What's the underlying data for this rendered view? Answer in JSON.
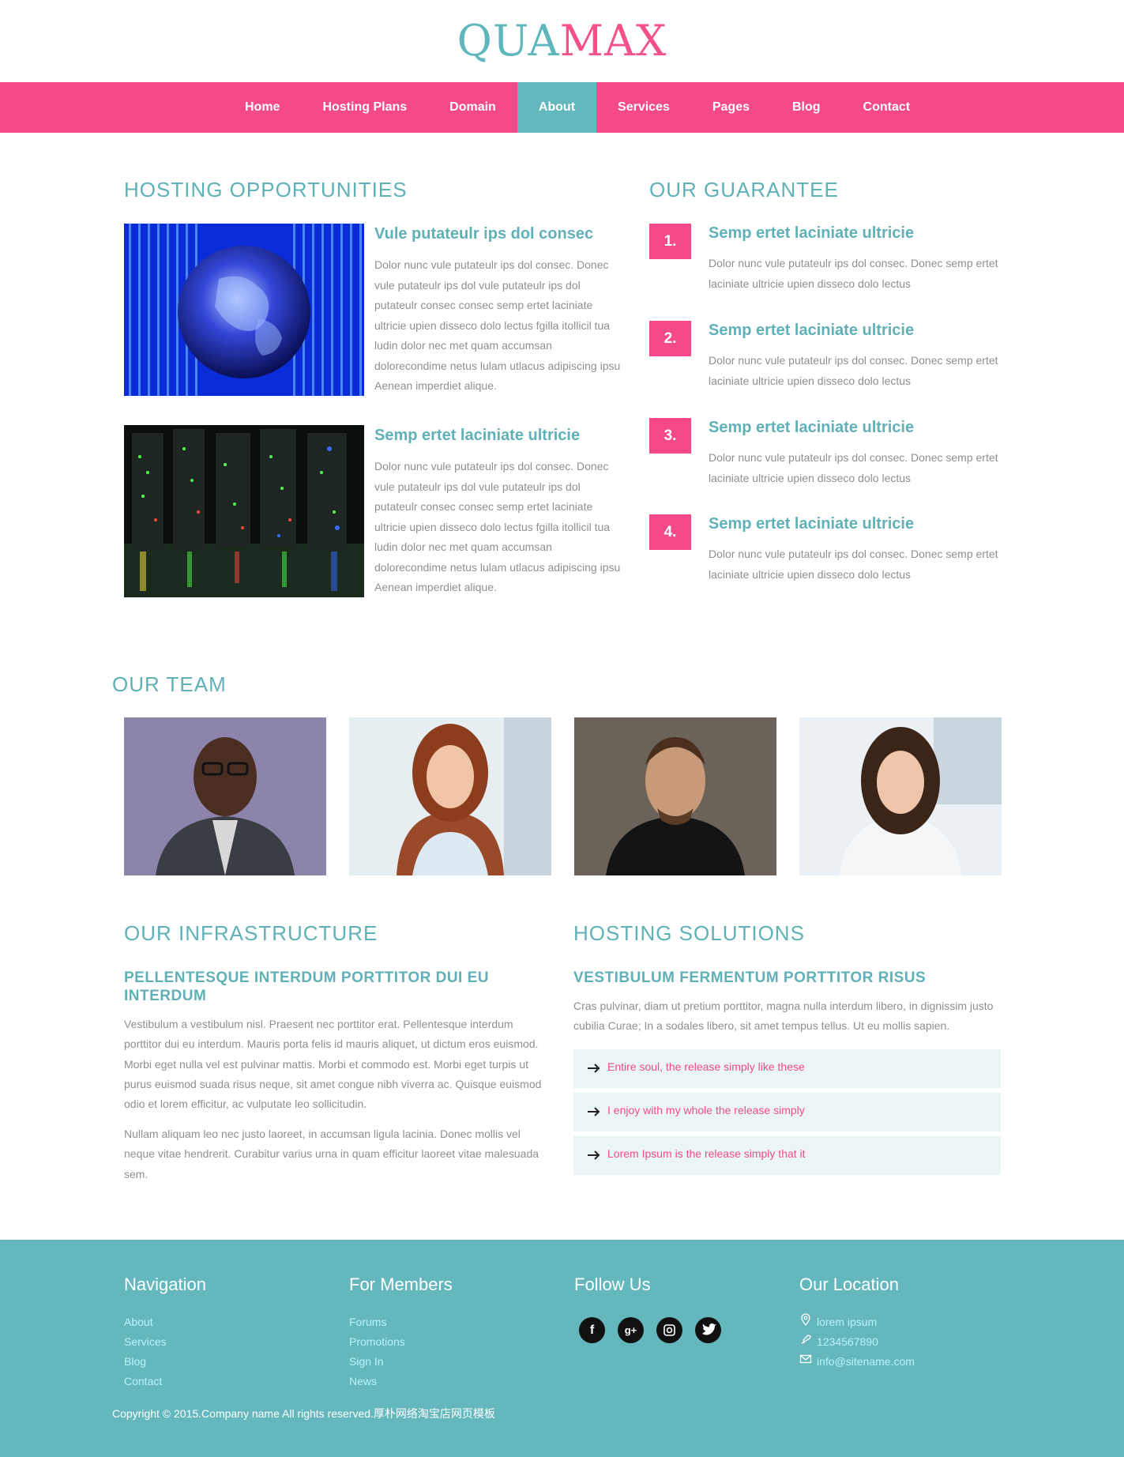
{
  "brand": {
    "part1": "QUA",
    "part2": "MAX",
    "color_primary": "#5fb7bd",
    "color_accent": "#f5508a"
  },
  "nav": {
    "items": [
      {
        "label": "Home"
      },
      {
        "label": "Hosting Plans"
      },
      {
        "label": "Domain"
      },
      {
        "label": "About",
        "active": true
      },
      {
        "label": "Services"
      },
      {
        "label": "Pages"
      },
      {
        "label": "Blog"
      },
      {
        "label": "Contact"
      }
    ]
  },
  "opportunities": {
    "heading": "HOSTING OPPORTUNITIES",
    "items": [
      {
        "title": "Vule putateulr ips dol consec",
        "text": "Dolor nunc vule putateulr ips dol consec. Donec vule putateulr ips dol vule putateulr ips dol putateulr consec consec semp ertet laciniate ultricie upien disseco dolo lectus fgilla itollicil tua ludin dolor nec met quam accumsan dolorecondime netus lulam utlacus adipiscing ipsu Aenean imperdiet alique.",
        "image": "globe-binary-image"
      },
      {
        "title": "Semp ertet laciniate ultricie",
        "text": "Dolor nunc vule putateulr ips dol consec. Donec vule putateulr ips dol vule putateulr ips dol putateulr consec consec semp ertet laciniate ultricie upien disseco dolo lectus fgilla itollicil tua ludin dolor nec met quam accumsan dolorecondime netus lulam utlacus adipiscing ipsu Aenean imperdiet alique.",
        "image": "server-room-image"
      }
    ]
  },
  "guarantee": {
    "heading": "OUR GUARANTEE",
    "items": [
      {
        "num": "1.",
        "title": "Semp ertet laciniate ultricie",
        "text": "Dolor nunc vule putateulr ips dol consec. Donec semp ertet laciniate ultricie upien disseco dolo lectus"
      },
      {
        "num": "2.",
        "title": "Semp ertet laciniate ultricie",
        "text": "Dolor nunc vule putateulr ips dol consec. Donec semp ertet laciniate ultricie upien disseco dolo lectus"
      },
      {
        "num": "3.",
        "title": "Semp ertet laciniate ultricie",
        "text": "Dolor nunc vule putateulr ips dol consec. Donec semp ertet laciniate ultricie upien disseco dolo lectus"
      },
      {
        "num": "4.",
        "title": "Semp ertet laciniate ultricie",
        "text": "Dolor nunc vule putateulr ips dol consec. Donec semp ertet laciniate ultricie upien disseco dolo lectus"
      }
    ]
  },
  "team": {
    "heading": "OUR TEAM",
    "members": [
      "team-member-man-glasses",
      "team-member-woman-redhair",
      "team-member-man-black-shirt",
      "team-member-woman-smiling"
    ]
  },
  "infrastructure": {
    "heading": "OUR INFRASTRUCTURE",
    "subheading": "PELLENTESQUE INTERDUM PORTTITOR DUI EU INTERDUM",
    "para1": "Vestibulum a vestibulum nisl. Praesent nec porttitor erat. Pellentesque interdum porttitor dui eu interdum. Mauris porta felis id mauris aliquet, ut dictum eros euismod. Morbi eget nulla vel est pulvinar mattis. Morbi et commodo est. Morbi eget turpis ut purus euismod suada risus neque, sit amet congue nibh viverra ac. Quisque euismod odio et lorem efficitur, ac vulputate leo sollicitudin.",
    "para2": "Nullam aliquam leo nec justo laoreet, in accumsan ligula lacinia. Donec mollis vel neque vitae hendrerit. Curabitur varius urna in quam efficitur laoreet vitae malesuada sem."
  },
  "solutions": {
    "heading": "HOSTING SOLUTIONS",
    "subheading": "VESTIBULUM FERMENTUM PORTTITOR RISUS",
    "para": "Cras pulvinar, diam ut pretium porttitor, magna nulla interdum libero, in dignissim justo cubilia Curae; In a sodales libero, sit amet tempus tellus. Ut eu mollis sapien.",
    "items": [
      {
        "label": "Entire soul, the release simply like these"
      },
      {
        "label": "I enjoy with my whole the release simply"
      },
      {
        "label": "Lorem Ipsum is the release simply that it"
      }
    ]
  },
  "footer": {
    "navigation": {
      "heading": "Navigation",
      "links": [
        "About",
        "Services",
        "Blog",
        "Contact"
      ]
    },
    "members": {
      "heading": "For Members",
      "links": [
        "Forums",
        "Promotions",
        "Sign In",
        "News"
      ]
    },
    "follow": {
      "heading": "Follow Us",
      "icons": [
        "facebook-icon",
        "google-plus-icon",
        "instagram-icon",
        "twitter-icon"
      ]
    },
    "location": {
      "heading": "Our Location",
      "address": "lorem ipsum",
      "phone": "1234567890",
      "email": "info@sitename.com"
    },
    "copyright": "Copyright © 2015.Company name All rights reserved.厚朴网络淘宝店网页模板"
  }
}
